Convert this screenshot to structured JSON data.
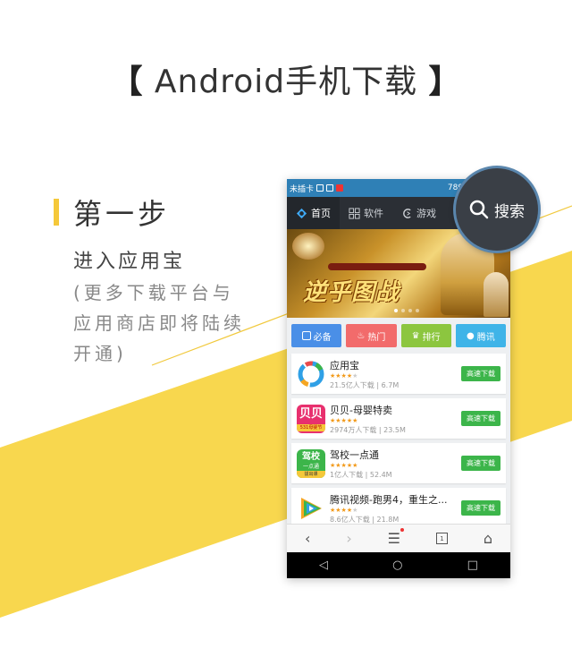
{
  "page": {
    "headline_open": "【",
    "headline": "Android手机下载",
    "headline_close": "】"
  },
  "step": {
    "title": "第一步",
    "subtitle": "进入应用宝",
    "description": "(更多下载平台与应用商店即将陆续开通)"
  },
  "phone": {
    "status": {
      "carrier": "未插卡",
      "speed": "789B/s",
      "battery": "18"
    },
    "tabs": [
      {
        "label": "首页",
        "icon": "home-icon"
      },
      {
        "label": "软件",
        "icon": "grid-icon"
      },
      {
        "label": "游戏",
        "icon": "game-icon"
      }
    ],
    "search_label": "搜索",
    "banner": {
      "text": "逆乎图战"
    },
    "categories": [
      {
        "label": "必备",
        "color": "#4a8fe7"
      },
      {
        "label": "热门",
        "color": "#f26b6b"
      },
      {
        "label": "排行",
        "color": "#8cc63f"
      },
      {
        "label": "腾讯",
        "color": "#3fb4e8"
      }
    ],
    "apps": [
      {
        "name": "应用宝",
        "stars": 4,
        "meta": "21.5亿人下载 | 6.7M",
        "button": "高速下载"
      },
      {
        "name": "贝贝-母婴特卖",
        "stars": 5,
        "meta": "2974万人下载 | 23.5M",
        "button": "高速下载"
      },
      {
        "name": "驾校一点通",
        "stars": 5,
        "meta": "1亿人下载 | 52.4M",
        "button": "高速下载"
      },
      {
        "name": "腾讯视频-跑男4，重生之...",
        "stars": 4,
        "meta": "8.6亿人下载 | 21.8M",
        "button": "高速下载"
      }
    ],
    "browser": {
      "back": "‹",
      "forward": "›",
      "menu": "☰",
      "tabs_count": "1",
      "home": "⌂"
    },
    "system": {
      "back": "◁",
      "home": "○",
      "recent": "□"
    }
  },
  "colors": {
    "accent_yellow": "#f5c83a",
    "status_blue": "#2f80b6",
    "download_green": "#3cb54a"
  }
}
